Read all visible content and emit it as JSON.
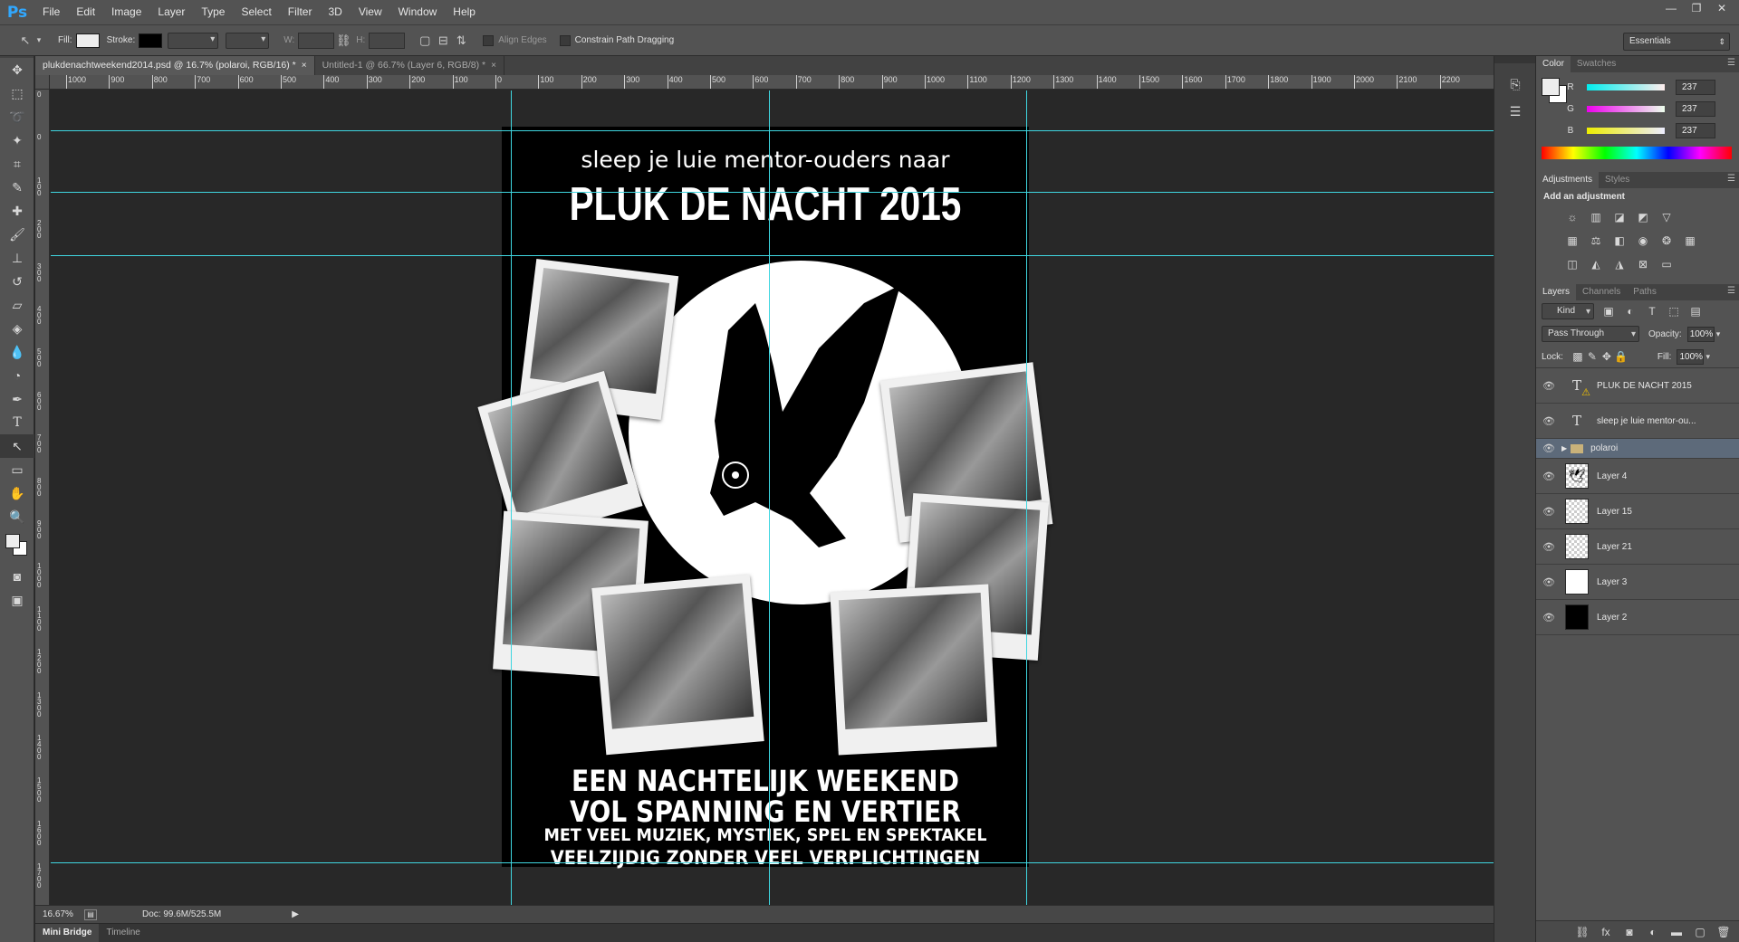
{
  "app": {
    "logo": "Ps"
  },
  "menu": [
    "File",
    "Edit",
    "Image",
    "Layer",
    "Type",
    "Select",
    "Filter",
    "3D",
    "View",
    "Window",
    "Help"
  ],
  "window_controls": [
    "—",
    "❐",
    "✕"
  ],
  "options": {
    "fill_label": "Fill:",
    "stroke_label": "Stroke:",
    "w_label": "W:",
    "h_label": "H:",
    "align_edges": "Align Edges",
    "constrain": "Constrain Path Dragging",
    "workspace": "Essentials"
  },
  "tabs": [
    {
      "label": "plukdenachtweekend2014.psd @ 16.7% (polaroi, RGB/16) *",
      "active": true
    },
    {
      "label": "Untitled-1 @ 66.7% (Layer 6, RGB/8) *",
      "active": false
    }
  ],
  "ruler_h": [
    "1000",
    "900",
    "800",
    "700",
    "600",
    "500",
    "400",
    "300",
    "200",
    "100",
    "0",
    "100",
    "200",
    "300",
    "400",
    "500",
    "600",
    "700",
    "800",
    "900",
    "1000",
    "1100",
    "1200",
    "1300",
    "1400",
    "1500",
    "1600",
    "1700",
    "1800",
    "1900",
    "2000",
    "2100",
    "2200"
  ],
  "ruler_v": [
    "0",
    "0",
    "1 0 0",
    "2 0 0",
    "3 0 0",
    "4 0 0",
    "5 0 0",
    "6 0 0",
    "7 0 0",
    "8 0 0",
    "9 0 0",
    "1 0 0 0",
    "1 1 0 0",
    "1 2 0 0",
    "1 3 0 0",
    "1 4 0 0",
    "1 5 0 0",
    "1 6 0 0",
    "1 7 0 0",
    "1 8 0 0",
    "1 9 0 0"
  ],
  "poster": {
    "line1": "sleep je luie mentor-ouders naar",
    "line2": "PLUK DE NACHT 2015",
    "bottom1": "EEN NACHTELIJK WEEKEND",
    "bottom2": "VOL SPANNING EN VERTIER",
    "bottom3": "MET VEEL MUZIEK, MYSTIEK, SPEL EN SPEKTAKEL",
    "bottom4": "VEELZIJDIG ZONDER VEEL VERPLICHTINGEN"
  },
  "status": {
    "zoom": "16.67%",
    "doc": "Doc: 99.6M/525.5M"
  },
  "bottom_tabs": [
    "Mini Bridge",
    "Timeline"
  ],
  "color_panel": {
    "tabs": [
      "Color",
      "Swatches"
    ],
    "r_label": "R",
    "g_label": "G",
    "b_label": "B",
    "r": "237",
    "g": "237",
    "b": "237"
  },
  "adjustments": {
    "tabs": [
      "Adjustments",
      "Styles"
    ],
    "title": "Add an adjustment"
  },
  "layers_panel": {
    "tabs": [
      "Layers",
      "Channels",
      "Paths"
    ],
    "kind": "Kind",
    "blend": "Pass Through",
    "opacity_label": "Opacity:",
    "opacity": "100%",
    "lock_label": "Lock:",
    "fill_label": "Fill:",
    "fill": "100%",
    "layers": [
      {
        "name": "PLUK DE NACHT 2015",
        "type": "text-warning"
      },
      {
        "name": "sleep je luie mentor-ou...",
        "type": "text"
      },
      {
        "name": "polaroi",
        "type": "group",
        "selected": true
      },
      {
        "name": "Layer 4",
        "type": "owl"
      },
      {
        "name": "Layer 15",
        "type": "checker"
      },
      {
        "name": "Layer 21",
        "type": "checker"
      },
      {
        "name": "Layer 3",
        "type": "white"
      },
      {
        "name": "Layer 2",
        "type": "black"
      }
    ]
  },
  "colors": {
    "guide": "#3fd6e0",
    "accent": "#31a8ff"
  }
}
